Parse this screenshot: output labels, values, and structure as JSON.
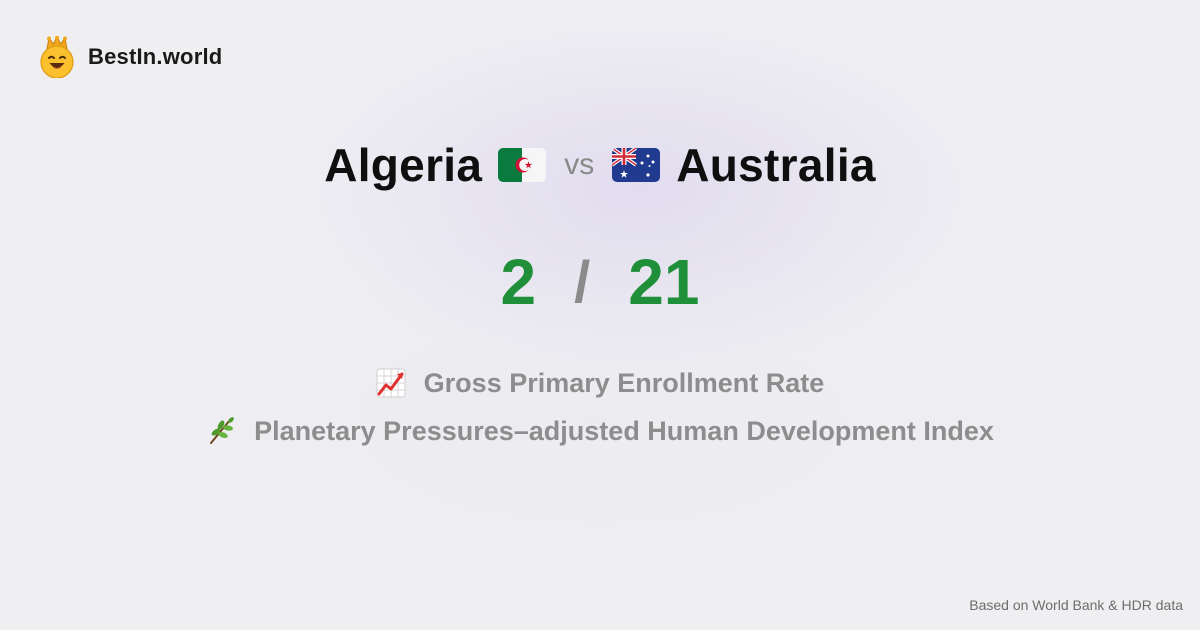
{
  "brand": {
    "name": "BestIn.world",
    "logo_icon": "crown-smiley-icon"
  },
  "comparison": {
    "country_a": {
      "name": "Algeria",
      "flag_icon": "algeria-flag-icon"
    },
    "vs_label": "vs",
    "country_b": {
      "name": "Australia",
      "flag_icon": "australia-flag-icon"
    }
  },
  "score": {
    "a": "2",
    "separator": "/",
    "b": "21",
    "color": "#1f8f3a"
  },
  "metrics": [
    {
      "icon": "chart-increasing-icon",
      "label": "Gross Primary Enrollment Rate"
    },
    {
      "icon": "herb-icon",
      "label": "Planetary Pressures–adjusted Human Development Index"
    }
  ],
  "footer": {
    "text": "Based on World Bank & HDR data"
  }
}
